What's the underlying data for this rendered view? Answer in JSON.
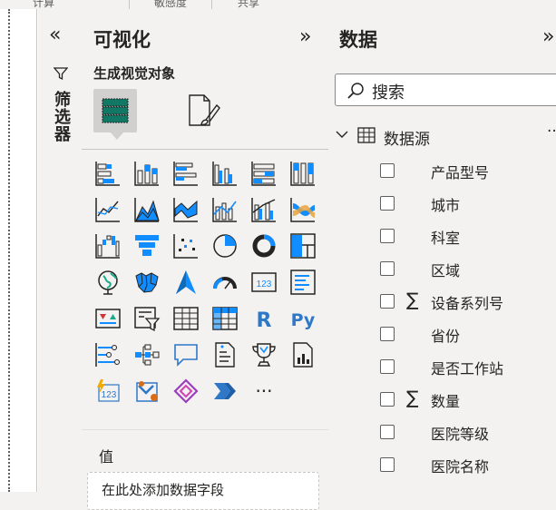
{
  "ribbon": {
    "item1": "计算",
    "item2": "敏感度",
    "item3": "共享"
  },
  "filters_pane": {
    "title": "筛选器",
    "collapse_glyph": "«",
    "funnel_glyph": "▽"
  },
  "viz_pane": {
    "title": "可视化",
    "expand_glyph": "»",
    "build_label": "生成视觉对象",
    "values_label": "值",
    "add_field_text": "在此处添加数据字段",
    "more_glyph": "···"
  },
  "data_pane": {
    "title": "数据",
    "expand_glyph": "»",
    "search_placeholder": "搜索",
    "tree": {
      "chevron": "⌵",
      "table_name": "数据源",
      "more": "···"
    },
    "fields": [
      {
        "name": "产品型号",
        "sigma": ""
      },
      {
        "name": "城市",
        "sigma": ""
      },
      {
        "name": "科室",
        "sigma": ""
      },
      {
        "name": "区域",
        "sigma": ""
      },
      {
        "name": "设备系列号",
        "sigma": "∑"
      },
      {
        "name": "省份",
        "sigma": ""
      },
      {
        "name": "是否工作站",
        "sigma": ""
      },
      {
        "name": "数量",
        "sigma": "∑"
      },
      {
        "name": "医院等级",
        "sigma": ""
      },
      {
        "name": "医院名称",
        "sigma": ""
      }
    ]
  },
  "viz_icons": [
    "stacked-bar-chart-icon",
    "stacked-column-chart-icon",
    "clustered-bar-chart-icon",
    "clustered-column-chart-icon",
    "100-stacked-bar-chart-icon",
    "100-stacked-column-chart-icon",
    "line-chart-icon",
    "area-chart-icon",
    "stacked-area-chart-icon",
    "line-and-column-chart-icon",
    "line-clustered-column-chart-icon",
    "ribbon-chart-icon",
    "waterfall-chart-icon",
    "funnel-chart-icon",
    "scatter-chart-icon",
    "pie-chart-icon",
    "donut-chart-icon",
    "treemap-icon",
    "map-icon",
    "filled-map-icon",
    "azure-map-icon",
    "gauge-icon",
    "card-icon",
    "multi-row-card-icon",
    "kpi-icon",
    "slicer-icon",
    "table-icon",
    "matrix-icon",
    "r-visual-icon",
    "python-visual-icon",
    "key-influencers-icon",
    "decomposition-tree-icon",
    "qa-icon",
    "smart-narrative-icon",
    "metrics-icon",
    "paginated-report-icon",
    "power-apps-icon",
    "power-automate-icon",
    "custom-visual-1-icon",
    "custom-visual-2-icon",
    "more-visuals-icon"
  ],
  "colors": {
    "accent": "#118dff",
    "teal": "#1aab8a",
    "dark": "#252423",
    "build_green": "#117865"
  },
  "visual_labels": {
    "card": "123",
    "r": "R",
    "py": "Py",
    "pa": "123"
  }
}
